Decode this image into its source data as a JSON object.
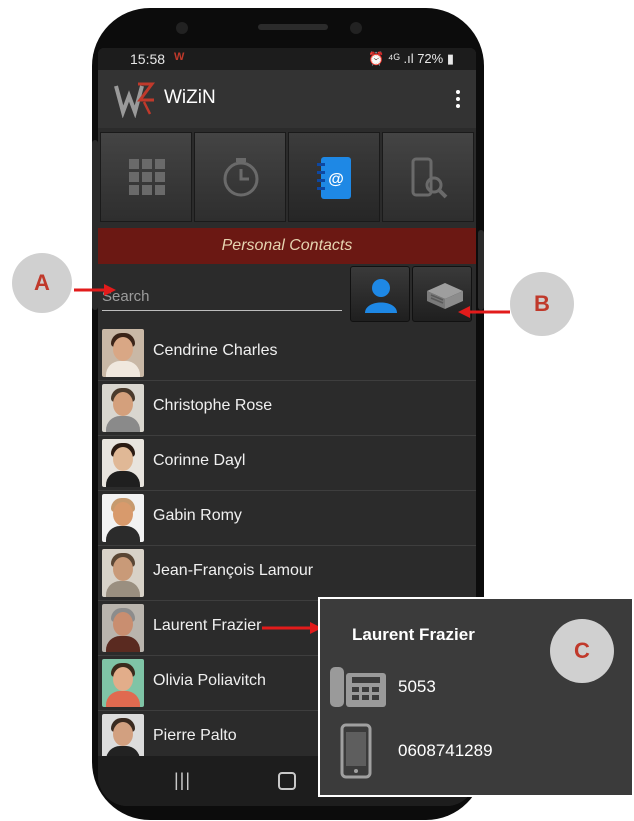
{
  "status_bar": {
    "time": "15:58",
    "app_indicator": "W",
    "icons_text": "⏰ ⁴ᴳ .ıl 72% ▮"
  },
  "app_bar": {
    "title": "WiZiN",
    "logo": "wizin-logo",
    "menu_icon": "overflow-menu-icon"
  },
  "tabs": [
    {
      "icon": "dialpad-grid-icon",
      "active": false
    },
    {
      "icon": "history-clock-icon",
      "active": false
    },
    {
      "icon": "contacts-book-icon",
      "active": true
    },
    {
      "icon": "directory-search-icon",
      "active": false
    }
  ],
  "section_title": "Personal Contacts",
  "search": {
    "placeholder": "Search",
    "value": ""
  },
  "buttons": {
    "personal": "person-icon",
    "company": "company-directory-icon"
  },
  "contacts": [
    {
      "name": "Cendrine Charles"
    },
    {
      "name": "Christophe Rose"
    },
    {
      "name": "Corinne Dayl"
    },
    {
      "name": "Gabin Romy"
    },
    {
      "name": "Jean-François Lamour"
    },
    {
      "name": "Laurent Frazier"
    },
    {
      "name": "Olivia Poliavitch"
    },
    {
      "name": "Pierre Palto"
    }
  ],
  "callouts": {
    "a": "A",
    "b": "B",
    "c": "C"
  },
  "popup": {
    "name": "Laurent Frazier",
    "office_number": "5053",
    "mobile_number": "0608741289"
  },
  "colors": {
    "accent_red": "#c0392b",
    "header_red": "#6b1813",
    "contacts_blue": "#1e88e5"
  }
}
